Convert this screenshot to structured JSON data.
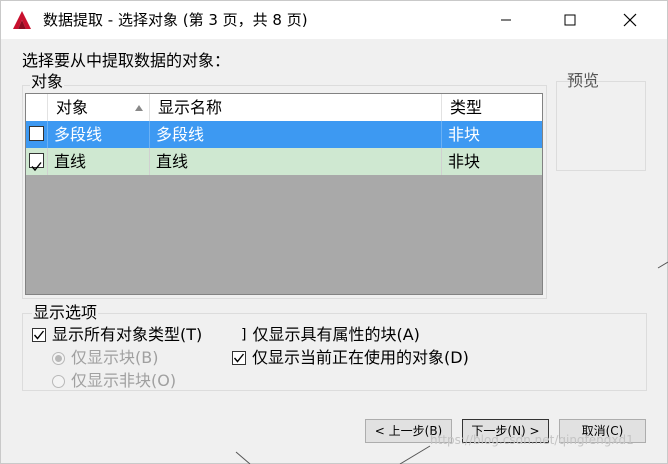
{
  "window": {
    "title": "数据提取 - 选择对象 (第 3 页，共 8 页)",
    "controls": {
      "minimize": "minimize-icon",
      "maximize": "maximize-icon",
      "close": "close-icon"
    }
  },
  "instruction": "选择要从中提取数据的对象：",
  "objects_group": {
    "legend": "对象",
    "columns": [
      "对象",
      "显示名称",
      "类型"
    ],
    "sort_indicator": "sort-ascending-icon",
    "rows": [
      {
        "checked": false,
        "object": "多段线",
        "display_name": "多段线",
        "type": "非块",
        "selected": true
      },
      {
        "checked": true,
        "object": "直线",
        "display_name": "直线",
        "type": "非块",
        "selected": false
      }
    ]
  },
  "preview": {
    "label": "预览"
  },
  "display_options": {
    "legend": "显示选项",
    "show_all_types": {
      "label": "显示所有对象类型(T)",
      "checked": true
    },
    "only_blocks": {
      "label": "仅显示块(B)",
      "selected": true,
      "enabled": false
    },
    "only_non_blocks": {
      "label": "仅显示非块(O)",
      "selected": false,
      "enabled": false
    },
    "only_attr_blocks": {
      "label": "仅显示具有属性的块(A)",
      "checked": false
    },
    "only_in_use": {
      "label": "仅显示当前正在使用的对象(D)",
      "checked": true
    }
  },
  "buttons": {
    "back": "< 上一步(B)",
    "next": "下一步(N) >",
    "cancel": "取消(C)"
  },
  "watermark": "https://blog.csdn.net/qingfengxd1",
  "colors": {
    "selection": "#3d99f2",
    "checked_row": "#cfe8d1",
    "empty_area": "#a9a9a9"
  }
}
